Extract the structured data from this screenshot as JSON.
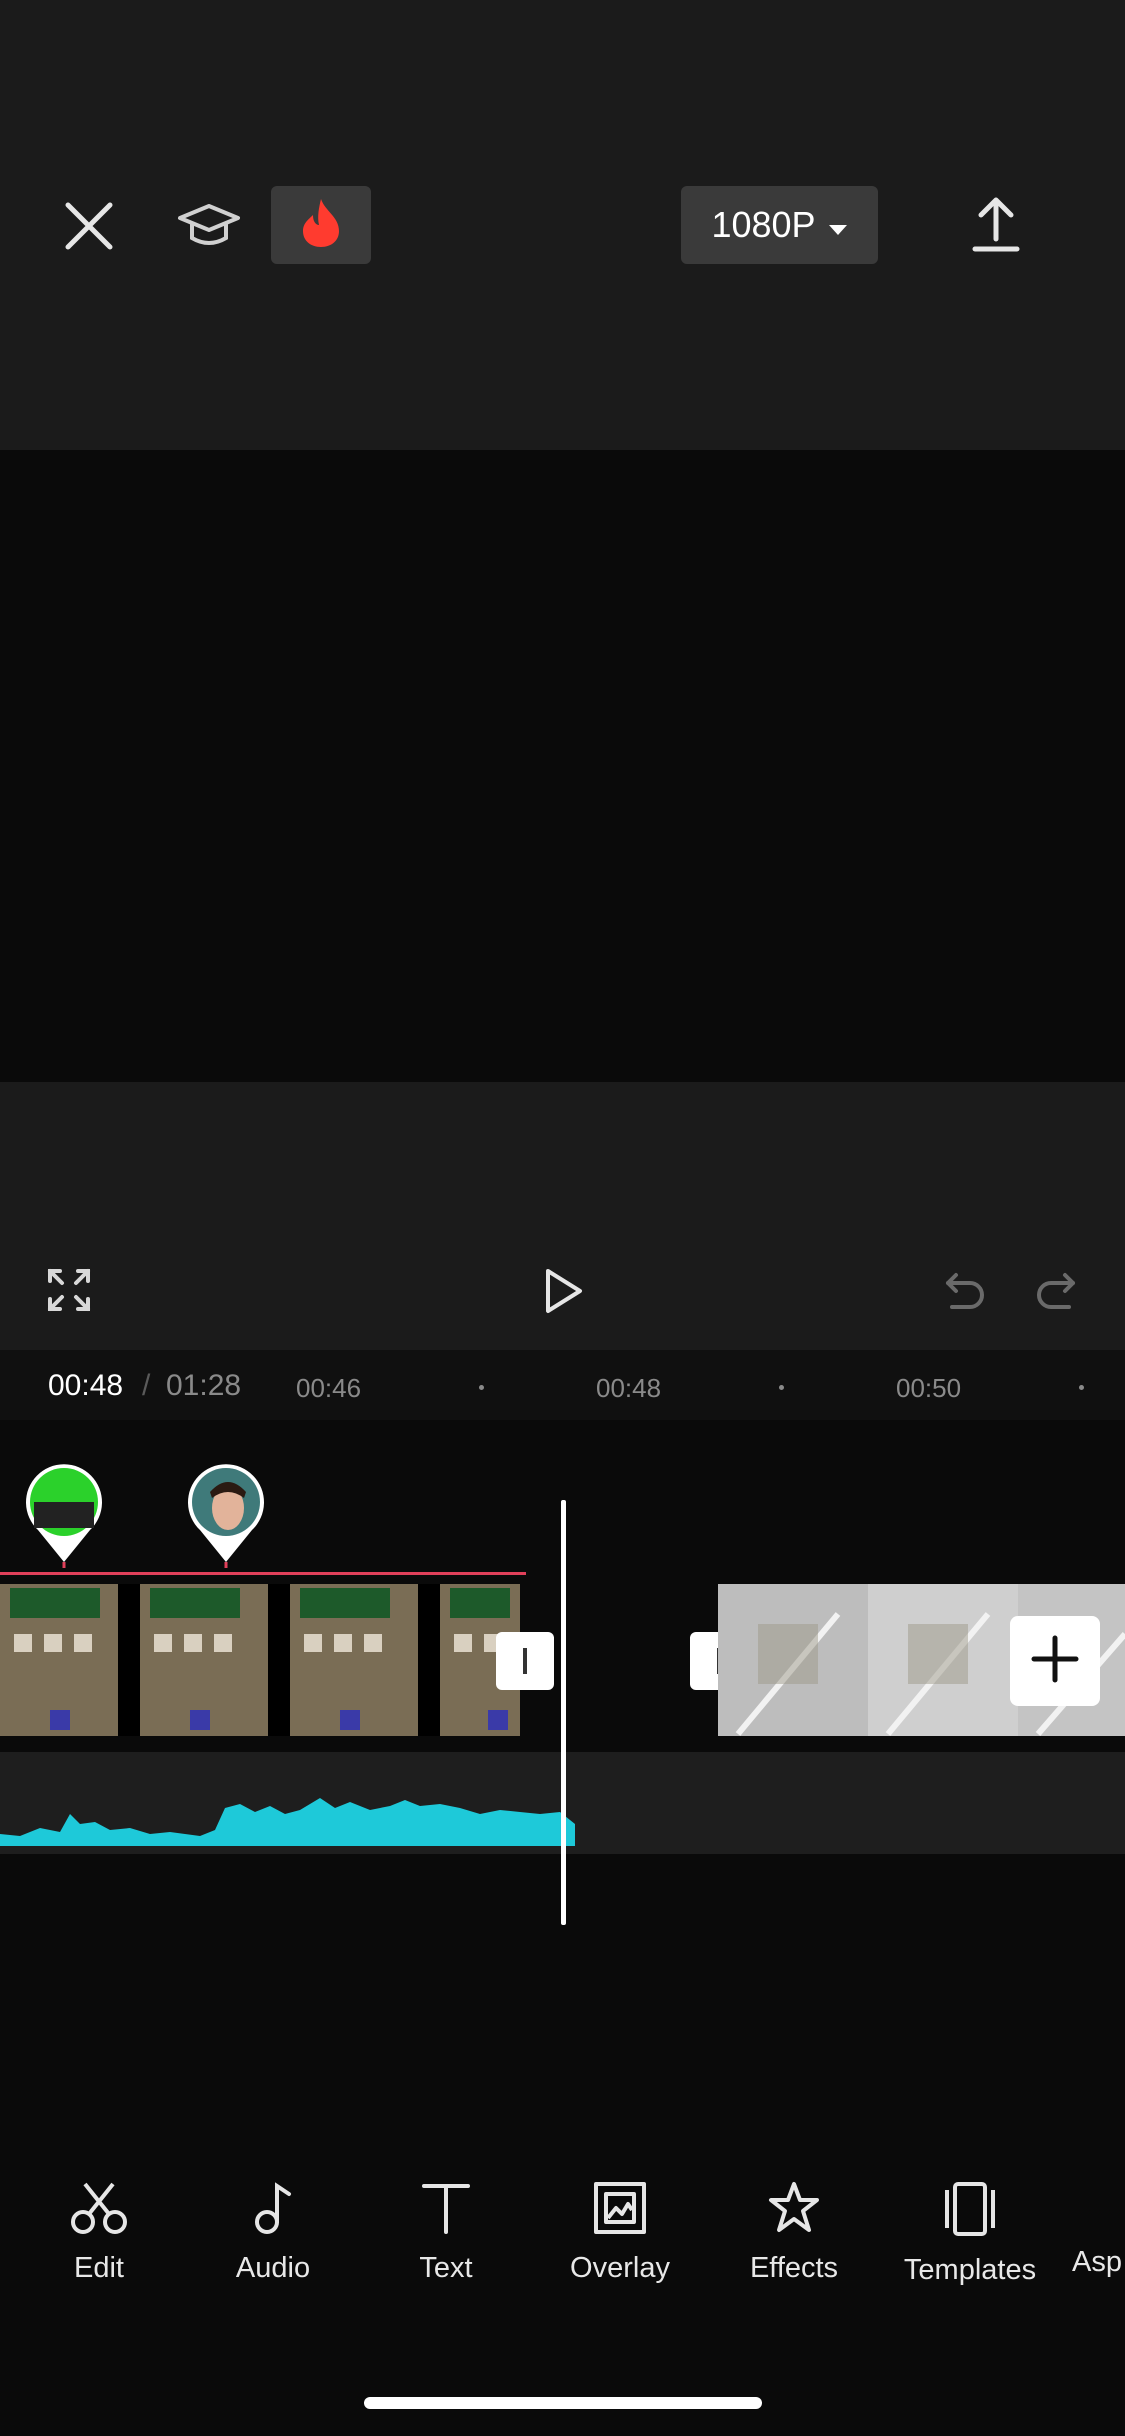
{
  "topbar": {
    "close_icon": "close-icon",
    "tutorial_icon": "graduation-cap-icon",
    "hot_icon": "flame-icon",
    "resolution_label": "1080P",
    "export_icon": "export-upload-icon"
  },
  "controls": {
    "fullscreen_icon": "fullscreen-icon",
    "play_icon": "play-icon",
    "undo_icon": "undo-icon",
    "redo_icon": "redo-icon"
  },
  "timeline": {
    "current_time": "00:48",
    "separator": "/",
    "total_time": "01:28",
    "ticks": [
      "00:46",
      "00:48",
      "00:50"
    ]
  },
  "toolbar": {
    "items": [
      {
        "label": "Edit",
        "icon": "scissors-icon"
      },
      {
        "label": "Audio",
        "icon": "music-note-icon"
      },
      {
        "label": "Text",
        "icon": "text-icon"
      },
      {
        "label": "Overlay",
        "icon": "overlay-icon"
      },
      {
        "label": "Effects",
        "icon": "effects-star-icon"
      },
      {
        "label": "Templates",
        "icon": "templates-icon"
      },
      {
        "label": "Asp",
        "icon": "aspect-icon"
      }
    ]
  },
  "colors": {
    "audio_wave": "#1ec9d9",
    "marker_line": "#e0405a",
    "accent_flame": "#ff3b2f"
  }
}
